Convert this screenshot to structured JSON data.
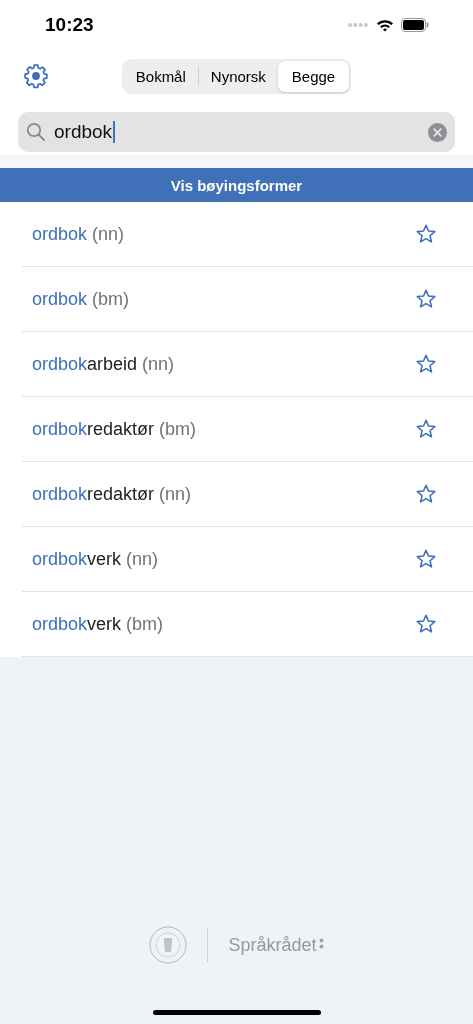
{
  "status_bar": {
    "time": "10:23"
  },
  "language_tabs": [
    {
      "label": "Bokmål",
      "selected": false
    },
    {
      "label": "Nynorsk",
      "selected": false
    },
    {
      "label": "Begge",
      "selected": true
    }
  ],
  "search": {
    "value": "ordbok"
  },
  "inflection_button": "Vis bøyingsformer",
  "results": [
    {
      "match": "ordbok",
      "language": "(nn)"
    },
    {
      "match": "ordbok",
      "language": "(bm)"
    },
    {
      "match": "ordbok",
      "rest": "arbeid",
      "language": "(nn)"
    },
    {
      "match": "ordbok",
      "rest": "redaktør",
      "language": "(bm)"
    },
    {
      "match": "ordbok",
      "rest": "redaktør",
      "language": "(nn)"
    },
    {
      "match": "ordbok",
      "rest": "verk",
      "language": "(nn)"
    },
    {
      "match": "ordbok",
      "rest": "verk",
      "language": "(bm)"
    }
  ],
  "footer": {
    "partner": "Språkrådet"
  }
}
